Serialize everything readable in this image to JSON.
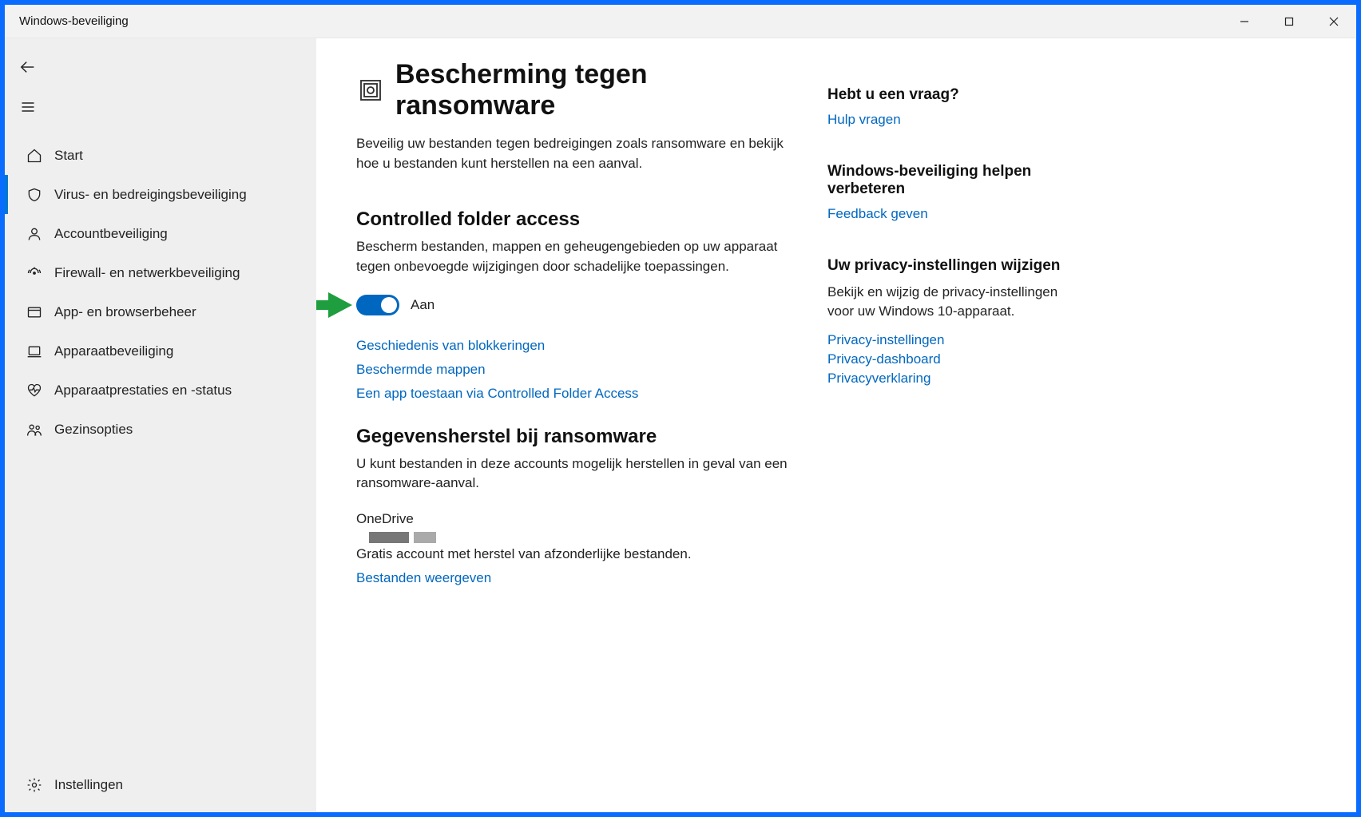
{
  "window": {
    "title": "Windows-beveiliging"
  },
  "sidebar": {
    "items": [
      {
        "label": "Start"
      },
      {
        "label": "Virus- en bedreigingsbeveiliging"
      },
      {
        "label": "Accountbeveiliging"
      },
      {
        "label": "Firewall- en netwerkbeveiliging"
      },
      {
        "label": "App- en browserbeheer"
      },
      {
        "label": "Apparaatbeveiliging"
      },
      {
        "label": "Apparaatprestaties en -status"
      },
      {
        "label": "Gezinsopties"
      }
    ],
    "settings_label": "Instellingen"
  },
  "page": {
    "title": "Bescherming tegen ransomware",
    "lead": "Beveilig uw bestanden tegen bedreigingen zoals ransomware en bekijk hoe u bestanden kunt herstellen na een aanval."
  },
  "cfa": {
    "title": "Controlled folder access",
    "desc": "Bescherm bestanden, mappen en geheugengebieden op uw apparaat tegen onbevoegde wijzigingen door schadelijke toepassingen.",
    "toggle_state": "Aan",
    "links": [
      "Geschiedenis van blokkeringen",
      "Beschermde mappen",
      "Een app toestaan via Controlled Folder Access"
    ]
  },
  "recovery": {
    "title": "Gegevensherstel bij ransomware",
    "desc": "U kunt bestanden in deze accounts mogelijk herstellen in geval van een ransomware-aanval.",
    "onedrive_label": "OneDrive",
    "onedrive_desc": "Gratis account met herstel van afzonderlijke bestanden.",
    "view_files": "Bestanden weergeven"
  },
  "aside": {
    "help_title": "Hebt u een vraag?",
    "help_link": "Hulp vragen",
    "improve_title": "Windows-beveiliging helpen verbeteren",
    "improve_link": "Feedback geven",
    "privacy_title": "Uw privacy-instellingen wijzigen",
    "privacy_desc": "Bekijk en wijzig de privacy-instellingen voor uw Windows 10-apparaat.",
    "privacy_links": [
      "Privacy-instellingen",
      "Privacy-dashboard",
      "Privacyverklaring"
    ]
  }
}
